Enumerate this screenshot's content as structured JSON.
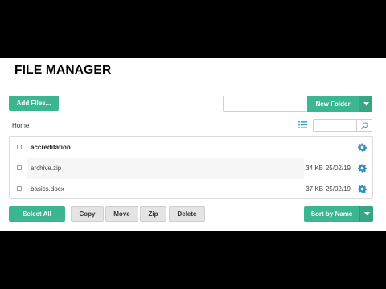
{
  "app": {
    "title": "FILE MANAGER"
  },
  "toolbar": {
    "add_files_label": "Add Files...",
    "new_folder_label": "New Folder",
    "new_folder_input_value": ""
  },
  "nav": {
    "breadcrumb": "Home"
  },
  "search": {
    "value": ""
  },
  "files": [
    {
      "name": "accreditation",
      "type": "folder",
      "size": "",
      "date": ""
    },
    {
      "name": "archive.zip",
      "type": "file",
      "size": "34 KB",
      "date": "25/02/19"
    },
    {
      "name": "basics.docx",
      "type": "file",
      "size": "37 KB",
      "date": "25/02/19"
    }
  ],
  "actions": {
    "select_all": "Select All",
    "copy": "Copy",
    "move": "Move",
    "zip": "Zip",
    "delete": "Delete",
    "sort": "Sort by Name"
  },
  "colors": {
    "accent": "#3cb68f",
    "accent_dark": "#35a783",
    "background": "#ffffff",
    "letterbox": "#000000"
  },
  "icons": {
    "dropdown": "chevron-down-icon",
    "list_view": "list-view-icon",
    "search": "search-icon",
    "settings": "gear-icon"
  }
}
